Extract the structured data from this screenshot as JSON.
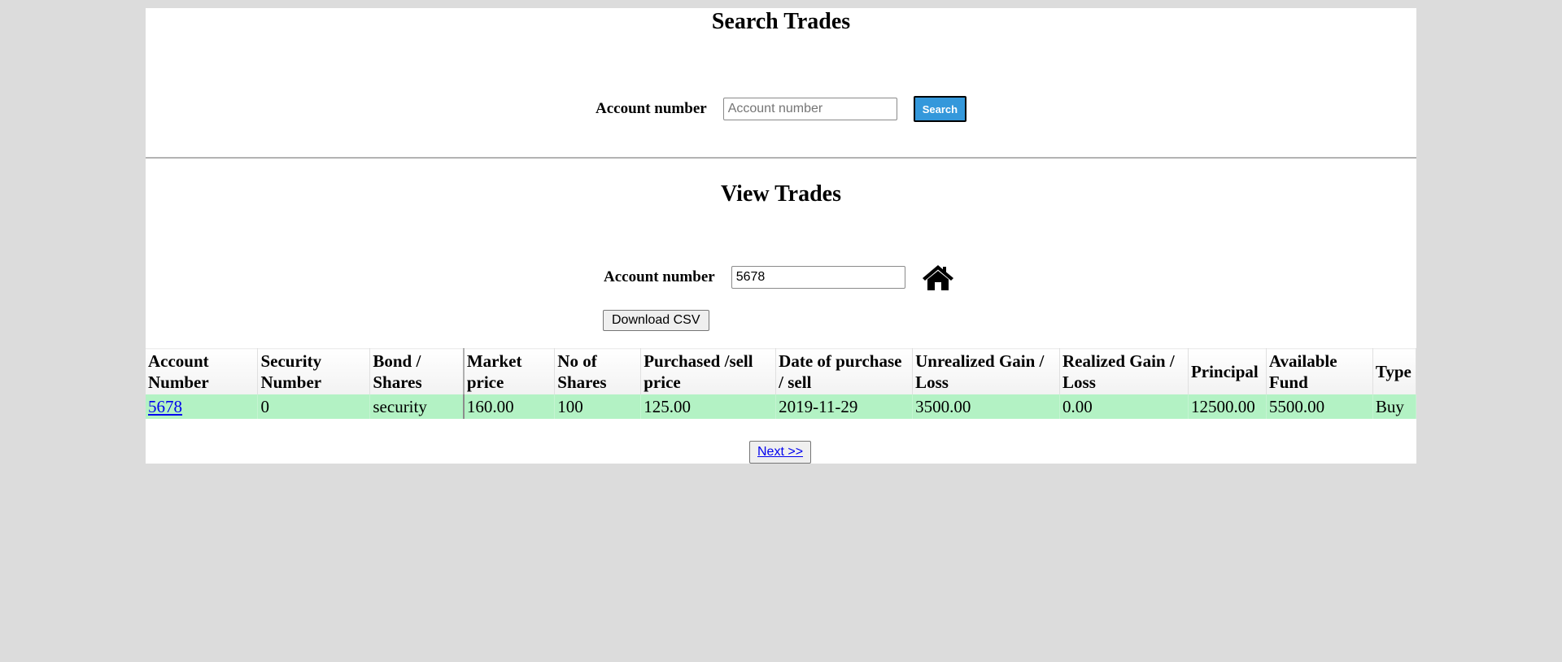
{
  "search_section": {
    "title": "Search Trades",
    "account_label": "Account number",
    "account_placeholder": "Account number",
    "account_value": "",
    "search_button": "Search"
  },
  "view_section": {
    "title": "View Trades",
    "account_label": "Account number",
    "account_value": "5678",
    "home_icon": "home-icon",
    "download_button": "Download CSV"
  },
  "table": {
    "columns": [
      "Account Number",
      "Security Number",
      "Bond / Shares",
      "Market price",
      "No of Shares",
      "Purchased /sell price",
      "Date of purchase / sell",
      "Unrealized Gain / Loss",
      "Realized Gain / Loss",
      "Principal",
      "Available Fund",
      "Type"
    ],
    "rows": [
      [
        "5678",
        "0",
        "security",
        "160.00",
        "100",
        "125.00",
        "2019-11-29",
        "3500.00",
        "0.00",
        "12500.00",
        "5500.00",
        "Buy"
      ]
    ]
  },
  "pagination": {
    "next_label": "Next >>"
  },
  "colors": {
    "page_background": "#dcdcdc",
    "search_button": "#3498db",
    "row_highlight": "#b3f2c4",
    "link": "#0000ee"
  }
}
